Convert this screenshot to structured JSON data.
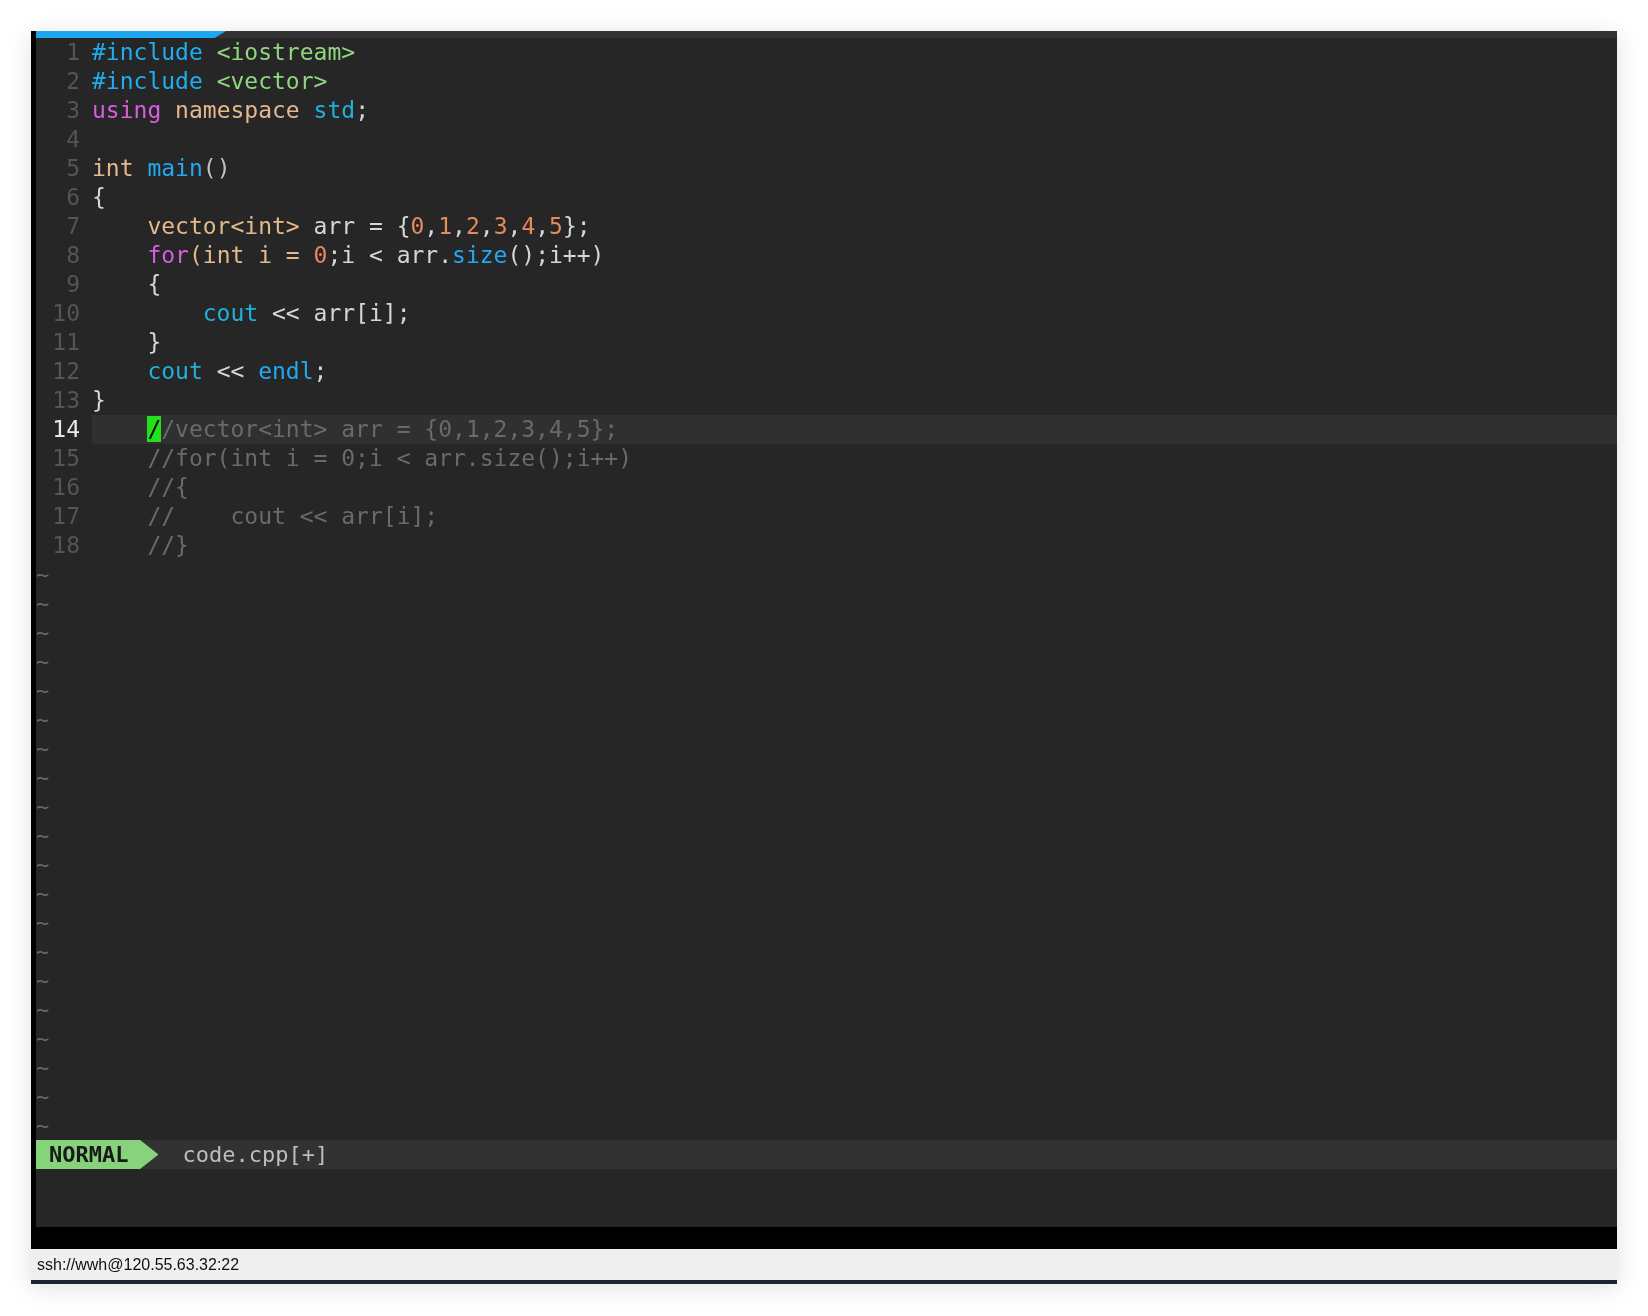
{
  "editor": {
    "lines": [
      {
        "number": "1",
        "current": false,
        "tokens": [
          {
            "text": "#include",
            "kind": "preproc"
          },
          {
            "text": " <iostream>",
            "kind": "string"
          }
        ]
      },
      {
        "number": "2",
        "current": false,
        "tokens": [
          {
            "text": "#include",
            "kind": "preproc"
          },
          {
            "text": " <vector>",
            "kind": "string"
          }
        ]
      },
      {
        "number": "3",
        "current": false,
        "tokens": [
          {
            "text": "using",
            "kind": "keyword"
          },
          {
            "text": " namespace ",
            "kind": "type"
          },
          {
            "text": "std",
            "kind": "name"
          },
          {
            "text": ";",
            "kind": "plain"
          }
        ]
      },
      {
        "number": "4",
        "current": false
      },
      {
        "number": "5",
        "current": false,
        "tokens": [
          {
            "text": "int ",
            "kind": "type"
          },
          {
            "text": "main",
            "kind": "function"
          },
          {
            "text": "()",
            "kind": "punct"
          }
        ]
      },
      {
        "number": "6",
        "current": false,
        "tokens": [
          {
            "text": "{",
            "kind": "plain"
          }
        ]
      },
      {
        "number": "7",
        "current": false,
        "tokens": [
          {
            "text": "    vector<int>",
            "kind": "type"
          },
          {
            "text": " arr = {",
            "kind": "plain"
          },
          {
            "text": "0",
            "kind": "number"
          },
          {
            "text": ",",
            "kind": "plain"
          },
          {
            "text": "1",
            "kind": "number"
          },
          {
            "text": ",",
            "kind": "plain"
          },
          {
            "text": "2",
            "kind": "number"
          },
          {
            "text": ",",
            "kind": "plain"
          },
          {
            "text": "3",
            "kind": "number"
          },
          {
            "text": ",",
            "kind": "plain"
          },
          {
            "text": "4",
            "kind": "number"
          },
          {
            "text": ",",
            "kind": "plain"
          },
          {
            "text": "5",
            "kind": "number"
          },
          {
            "text": "};",
            "kind": "plain"
          }
        ]
      },
      {
        "number": "8",
        "current": false,
        "tokens": [
          {
            "text": "    for",
            "kind": "keyword"
          },
          {
            "text": "(int i = ",
            "kind": "type"
          },
          {
            "text": "0",
            "kind": "number"
          },
          {
            "text": ";i < arr.",
            "kind": "plain"
          },
          {
            "text": "size",
            "kind": "function"
          },
          {
            "text": "();i++)",
            "kind": "plain"
          }
        ]
      },
      {
        "number": "9",
        "current": false,
        "tokens": [
          {
            "text": "    {",
            "kind": "plain"
          }
        ]
      },
      {
        "number": "10",
        "current": false,
        "tokens": [
          {
            "text": "        cout",
            "kind": "name"
          },
          {
            "text": " << arr[i];",
            "kind": "plain"
          }
        ]
      },
      {
        "number": "11",
        "current": false,
        "tokens": [
          {
            "text": "    }",
            "kind": "plain"
          }
        ]
      },
      {
        "number": "12",
        "current": false,
        "tokens": [
          {
            "text": "    cout",
            "kind": "name"
          },
          {
            "text": " << ",
            "kind": "plain"
          },
          {
            "text": "endl",
            "kind": "function"
          },
          {
            "text": ";",
            "kind": "plain"
          }
        ]
      },
      {
        "number": "13",
        "current": false,
        "tokens": [
          {
            "text": "}",
            "kind": "plain"
          }
        ]
      },
      {
        "number": "14",
        "current": true,
        "tokens": [
          {
            "text": "    /",
            "kind": "cursor"
          },
          {
            "text": "/vector<int> arr = {0,1,2,3,4,5};",
            "kind": "comment"
          }
        ]
      },
      {
        "number": "15",
        "current": false,
        "tokens": [
          {
            "text": "    //for(int i = 0;i < arr.size();i++)",
            "kind": "comment"
          }
        ]
      },
      {
        "number": "16",
        "current": false,
        "tokens": [
          {
            "text": "    //{",
            "kind": "comment"
          }
        ]
      },
      {
        "number": "17",
        "current": false,
        "tokens": [
          {
            "text": "    //    cout << arr[i];",
            "kind": "comment"
          }
        ]
      },
      {
        "number": "18",
        "current": false,
        "tokens": [
          {
            "text": "    //}",
            "kind": "comment"
          }
        ]
      }
    ],
    "filler": [
      "~",
      "~",
      "~",
      "~",
      "~",
      "~",
      "~",
      "~",
      "~",
      "~",
      "~",
      "~",
      "~",
      "~",
      "~",
      "~",
      "~",
      "~",
      "~",
      "~"
    ]
  },
  "status_line": {
    "mode": "NORMAL",
    "file": "code.cpp[+]"
  },
  "status_bar": {
    "connection": "ssh://wwh@120.55.63.32:22"
  }
}
